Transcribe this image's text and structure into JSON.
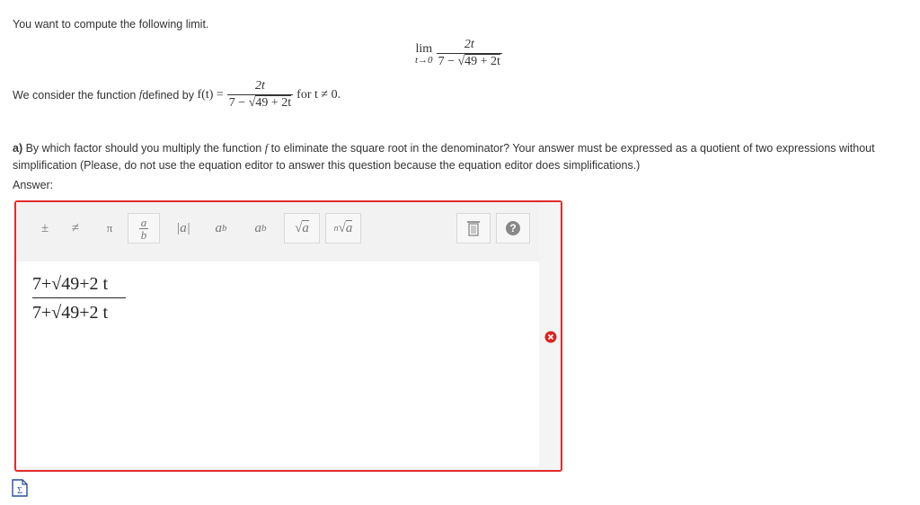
{
  "intro": "You want to compute the following limit.",
  "limit": {
    "op": "lim",
    "sub": "t→0",
    "num": "2t",
    "den_lead": "7 − ",
    "den_rad": "49 + 2t"
  },
  "func": {
    "lead": "We consider the function ",
    "fname": "f",
    "mid": " defined by ",
    "lhs": "f(t) =",
    "num": "2t",
    "den_lead": "7 − ",
    "den_rad": "49 + 2t",
    "cond": "for t ≠ 0."
  },
  "question": {
    "part": "a)",
    "text1": " By which factor should you multiply the function ",
    "fname": "f",
    "text2": " to eliminate the square root in the denominator? Your answer must be expressed as a quotient of two expressions without simplification (Please, do not use the equation editor to answer this question because the equation editor does simplifications.)"
  },
  "answer_label": "Answer:",
  "editor": {
    "answer_lines": [
      "7+√49+2 t",
      "7+√49+2 t"
    ],
    "tools": [
      "plus-minus",
      "not-equal",
      "pi",
      "fraction",
      "absolute-value",
      "superscript",
      "subscript",
      "square-root",
      "nth-root",
      "trash",
      "help"
    ]
  },
  "colors": {
    "error": "#e22a2a",
    "accent_help": "#888888"
  }
}
